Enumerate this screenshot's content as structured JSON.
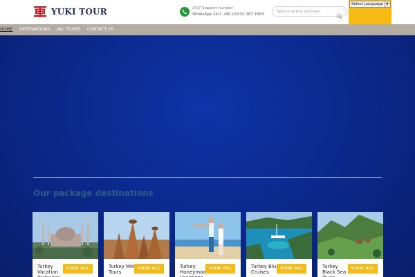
{
  "header": {
    "logo_text": "YUKI TOUR",
    "support_label": "24/7 Support number",
    "support_number": "WhatsApp 24/7 +90 (0)532 287 1663",
    "search_placeholder": "Search entire site here",
    "language_select": "Select Language"
  },
  "nav": {
    "items": [
      "HOME",
      "DESTINATIONS",
      "ALL TOURS",
      "CONTACT US"
    ]
  },
  "section": {
    "title": "Our package destinations"
  },
  "cards": [
    {
      "title": "Turkey Vacation Packages",
      "button": "VIEW ALL"
    },
    {
      "title": "Turkey Mini Tours",
      "button": "VIEW ALL"
    },
    {
      "title": "Turkey Honeymoon Vacations",
      "button": "VIEW ALL"
    },
    {
      "title": "Turkey Blue Cruises",
      "button": "VIEW ALL"
    },
    {
      "title": "Turkey Black Sea Tours",
      "button": "VIEW ALL"
    }
  ],
  "colors": {
    "accent": "#f6bb14",
    "nav_bg": "#b4aca3",
    "hero_bg": "#0b2a8e",
    "support_icon": "#1f9b34",
    "logo_red": "#c8202b"
  },
  "icons": {
    "logo": "logo-icon",
    "phone": "phone-icon",
    "search": "search-icon",
    "dropdown": "chevron-down-icon"
  }
}
